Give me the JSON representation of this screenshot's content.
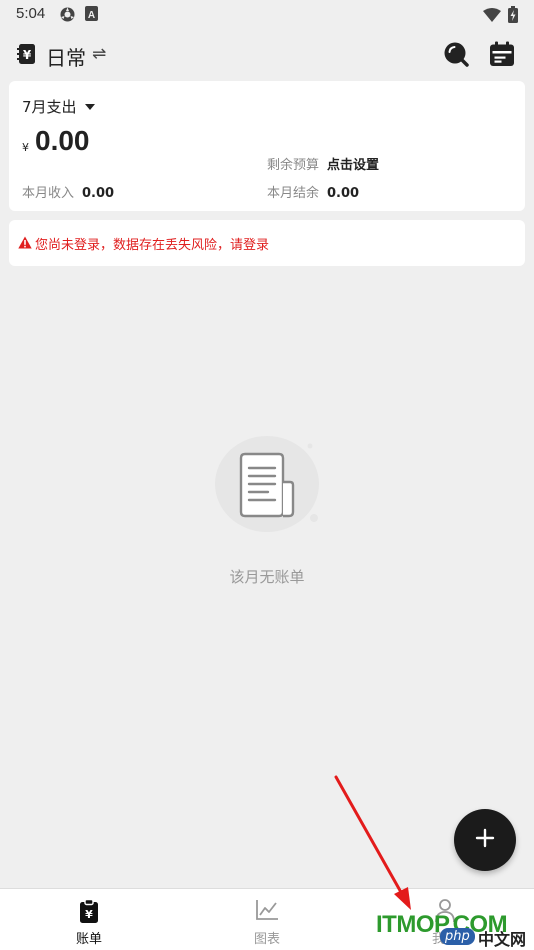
{
  "status_bar": {
    "time": "5:04",
    "icons": [
      "settings-gear-icon",
      "keyboard-a-icon",
      "wifi-icon",
      "battery-charging-icon"
    ]
  },
  "header": {
    "book_icon": "yen-book-icon",
    "book_title": "日常",
    "switch_glyph": "⇌",
    "actions": [
      "search-icon",
      "calendar-icon"
    ]
  },
  "summary": {
    "month_label": "7月支出",
    "currency_symbol": "¥",
    "expense": "0.00",
    "budget_label": "剩余预算",
    "budget_value": "点击设置",
    "income_label": "本月收入",
    "income_value": "0.00",
    "balance_label": "本月结余",
    "balance_value": "0.00"
  },
  "warning": {
    "text": "您尚未登录，数据存在丢失风险，请登录",
    "color": "#e02020"
  },
  "empty_state": {
    "icon": "receipt-icon",
    "text": "该月无账单"
  },
  "fab": {
    "icon": "plus-icon"
  },
  "bottom_nav": {
    "tabs": [
      {
        "label": "账单",
        "icon": "bill-clipboard-icon",
        "active": true
      },
      {
        "label": "图表",
        "icon": "chart-line-icon",
        "active": false
      },
      {
        "label": "我的",
        "icon": "person-icon",
        "active": false
      }
    ]
  },
  "watermark": {
    "brand": "ITMOP.COM",
    "badge": "php",
    "site": "中文网"
  },
  "colors": {
    "background": "#efefef",
    "card": "#ffffff",
    "accent_dark": "#1b1b1b",
    "warning_red": "#e02020",
    "watermark_green": "#2d9a2d",
    "arrow_red": "#e31b1b"
  }
}
